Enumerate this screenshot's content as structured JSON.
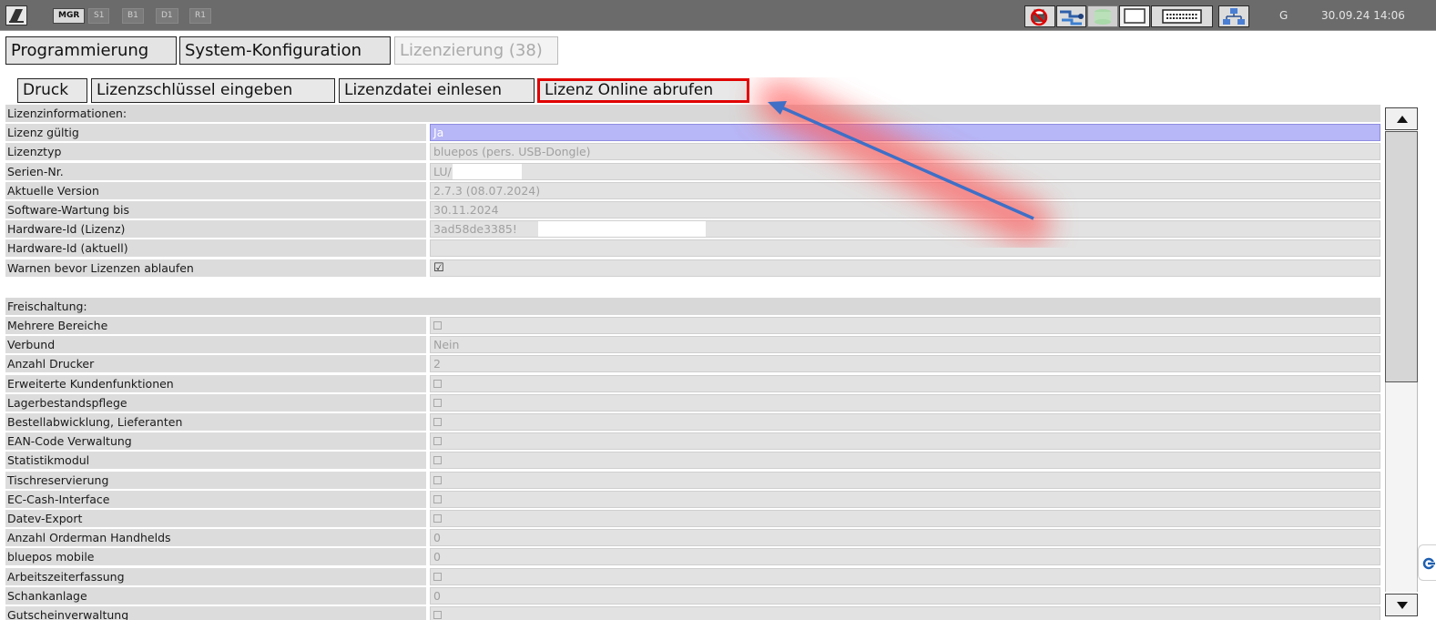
{
  "topbar": {
    "modes": [
      {
        "label": "MGR",
        "active": true
      },
      {
        "label": "S1",
        "active": false
      },
      {
        "label": "B1",
        "active": false
      },
      {
        "label": "D1",
        "active": false
      },
      {
        "label": "R1",
        "active": false
      }
    ],
    "icons": [
      "no-printer-icon",
      "network-connection-icon",
      "database-icon",
      "display-icon",
      "keyboard-icon",
      "network-tree-icon"
    ],
    "user": "G",
    "datetime": "30.09.24 14:06"
  },
  "main_tabs": [
    {
      "label": "Programmierung",
      "disabled": false
    },
    {
      "label": "System-Konfiguration",
      "disabled": false
    },
    {
      "label": "Lizenzierung (38)",
      "disabled": true
    }
  ],
  "toolbar": {
    "print_label": "Druck",
    "enter_key_label": "Lizenzschlüssel eingeben",
    "read_file_label": "Lizenzdatei einlesen",
    "fetch_online_label": "Lizenz Online abrufen"
  },
  "license_info": {
    "section_title": "Lizenzinformationen:",
    "rows": [
      {
        "label": "Lizenz gültig",
        "value": "Ja"
      },
      {
        "label": "Lizenztyp",
        "value": "bluepos (pers. USB-Dongle)"
      },
      {
        "label": "Serien-Nr.",
        "value": "LU/"
      },
      {
        "label": "Aktuelle Version",
        "value": "2.7.3 (08.07.2024)"
      },
      {
        "label": "Software-Wartung bis",
        "value": "30.11.2024"
      },
      {
        "label": "Hardware-Id (Lizenz)",
        "value": "3ad58de3385!"
      },
      {
        "label": "Hardware-Id (aktuell)",
        "value": ""
      },
      {
        "label": "Warnen bevor Lizenzen ablaufen",
        "value": "☑"
      }
    ]
  },
  "unlock": {
    "section_title": "Freischaltung:",
    "rows": [
      {
        "label": "Mehrere Bereiche",
        "value": "",
        "checkbox": true
      },
      {
        "label": "Verbund",
        "value": "Nein"
      },
      {
        "label": "Anzahl Drucker",
        "value": "2"
      },
      {
        "label": "Erweiterte Kundenfunktionen",
        "value": "",
        "checkbox": true
      },
      {
        "label": "Lagerbestandspflege",
        "value": "",
        "checkbox": true
      },
      {
        "label": "Bestellabwicklung, Lieferanten",
        "value": "",
        "checkbox": true
      },
      {
        "label": "EAN-Code Verwaltung",
        "value": "",
        "checkbox": true
      },
      {
        "label": "Statistikmodul",
        "value": "",
        "checkbox": true
      },
      {
        "label": "Tischreservierung",
        "value": "",
        "checkbox": true
      },
      {
        "label": "EC-Cash-Interface",
        "value": "",
        "checkbox": true
      },
      {
        "label": "Datev-Export",
        "value": "",
        "checkbox": true
      },
      {
        "label": "Anzahl Orderman Handhelds",
        "value": "0"
      },
      {
        "label": "bluepos mobile",
        "value": "0"
      },
      {
        "label": "Arbeitszeiterfassung",
        "value": "",
        "checkbox": true
      },
      {
        "label": "Schankanlage",
        "value": "0"
      },
      {
        "label": "Gutscheinverwaltung",
        "value": "",
        "checkbox": true
      }
    ]
  },
  "colors": {
    "highlight_row": "#b7b6f6",
    "button_highlight_border": "#e00000",
    "annotation_arrow": "#3f6fc6",
    "annotation_glow": "#ff5a5a"
  }
}
